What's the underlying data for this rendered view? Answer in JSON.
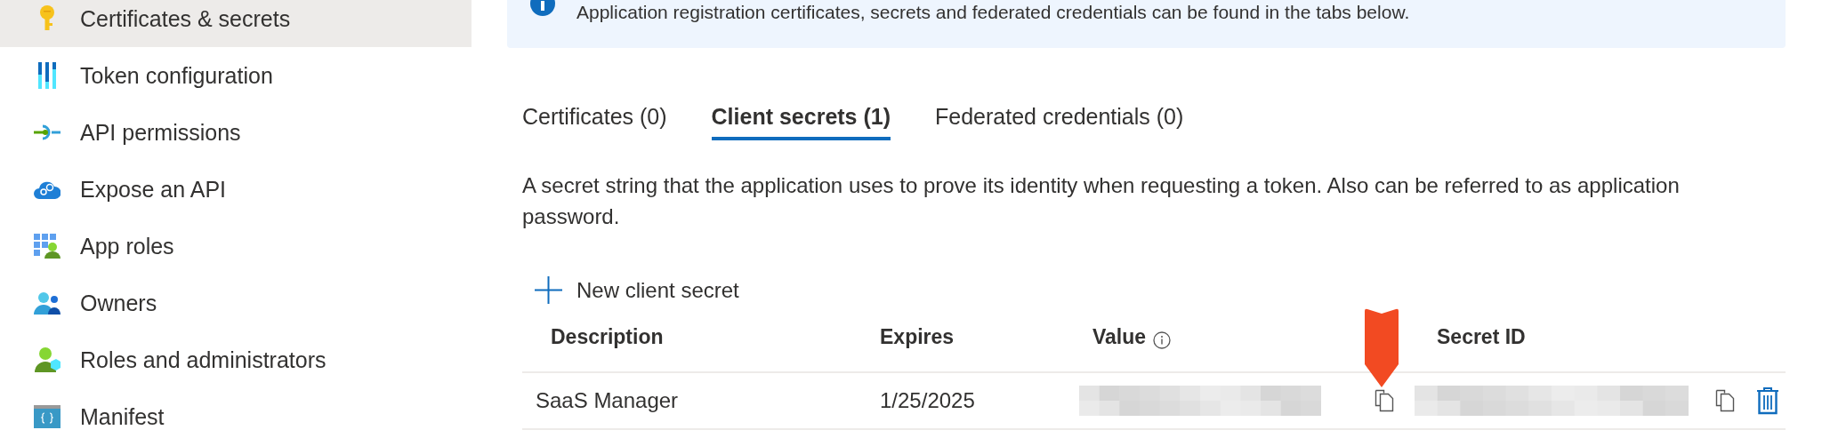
{
  "sidebar": {
    "items": [
      {
        "label": "Certificates & secrets",
        "selected": true
      },
      {
        "label": "Token configuration",
        "selected": false
      },
      {
        "label": "API permissions",
        "selected": false
      },
      {
        "label": "Expose an API",
        "selected": false
      },
      {
        "label": "App roles",
        "selected": false
      },
      {
        "label": "Owners",
        "selected": false
      },
      {
        "label": "Roles and administrators",
        "selected": false
      },
      {
        "label": "Manifest",
        "selected": false
      }
    ]
  },
  "banner": {
    "text": "Application registration certificates, secrets and federated credentials can be found in the tabs below."
  },
  "tabs": [
    {
      "label": "Certificates (0)",
      "selected": false
    },
    {
      "label": "Client secrets (1)",
      "selected": true
    },
    {
      "label": "Federated credentials (0)",
      "selected": false
    }
  ],
  "description": "A secret string that the application uses to prove its identity when requesting a token. Also can be referred to as application password.",
  "new_button": {
    "label": "New client secret"
  },
  "table": {
    "columns": [
      {
        "label": "Description",
        "info": false
      },
      {
        "label": "Expires",
        "info": false
      },
      {
        "label": "Value",
        "info": true
      },
      {
        "label": "Secret ID",
        "info": false
      }
    ],
    "rows": [
      {
        "cells": [
          {
            "kind": "text",
            "text": "SaaS Manager"
          },
          {
            "kind": "text",
            "text": "1/25/2025"
          },
          {
            "kind": "redacted",
            "copy": true
          },
          {
            "kind": "redacted",
            "copy": true
          }
        ],
        "deletable": true
      }
    ]
  },
  "marker": {
    "kind": "arrow"
  }
}
